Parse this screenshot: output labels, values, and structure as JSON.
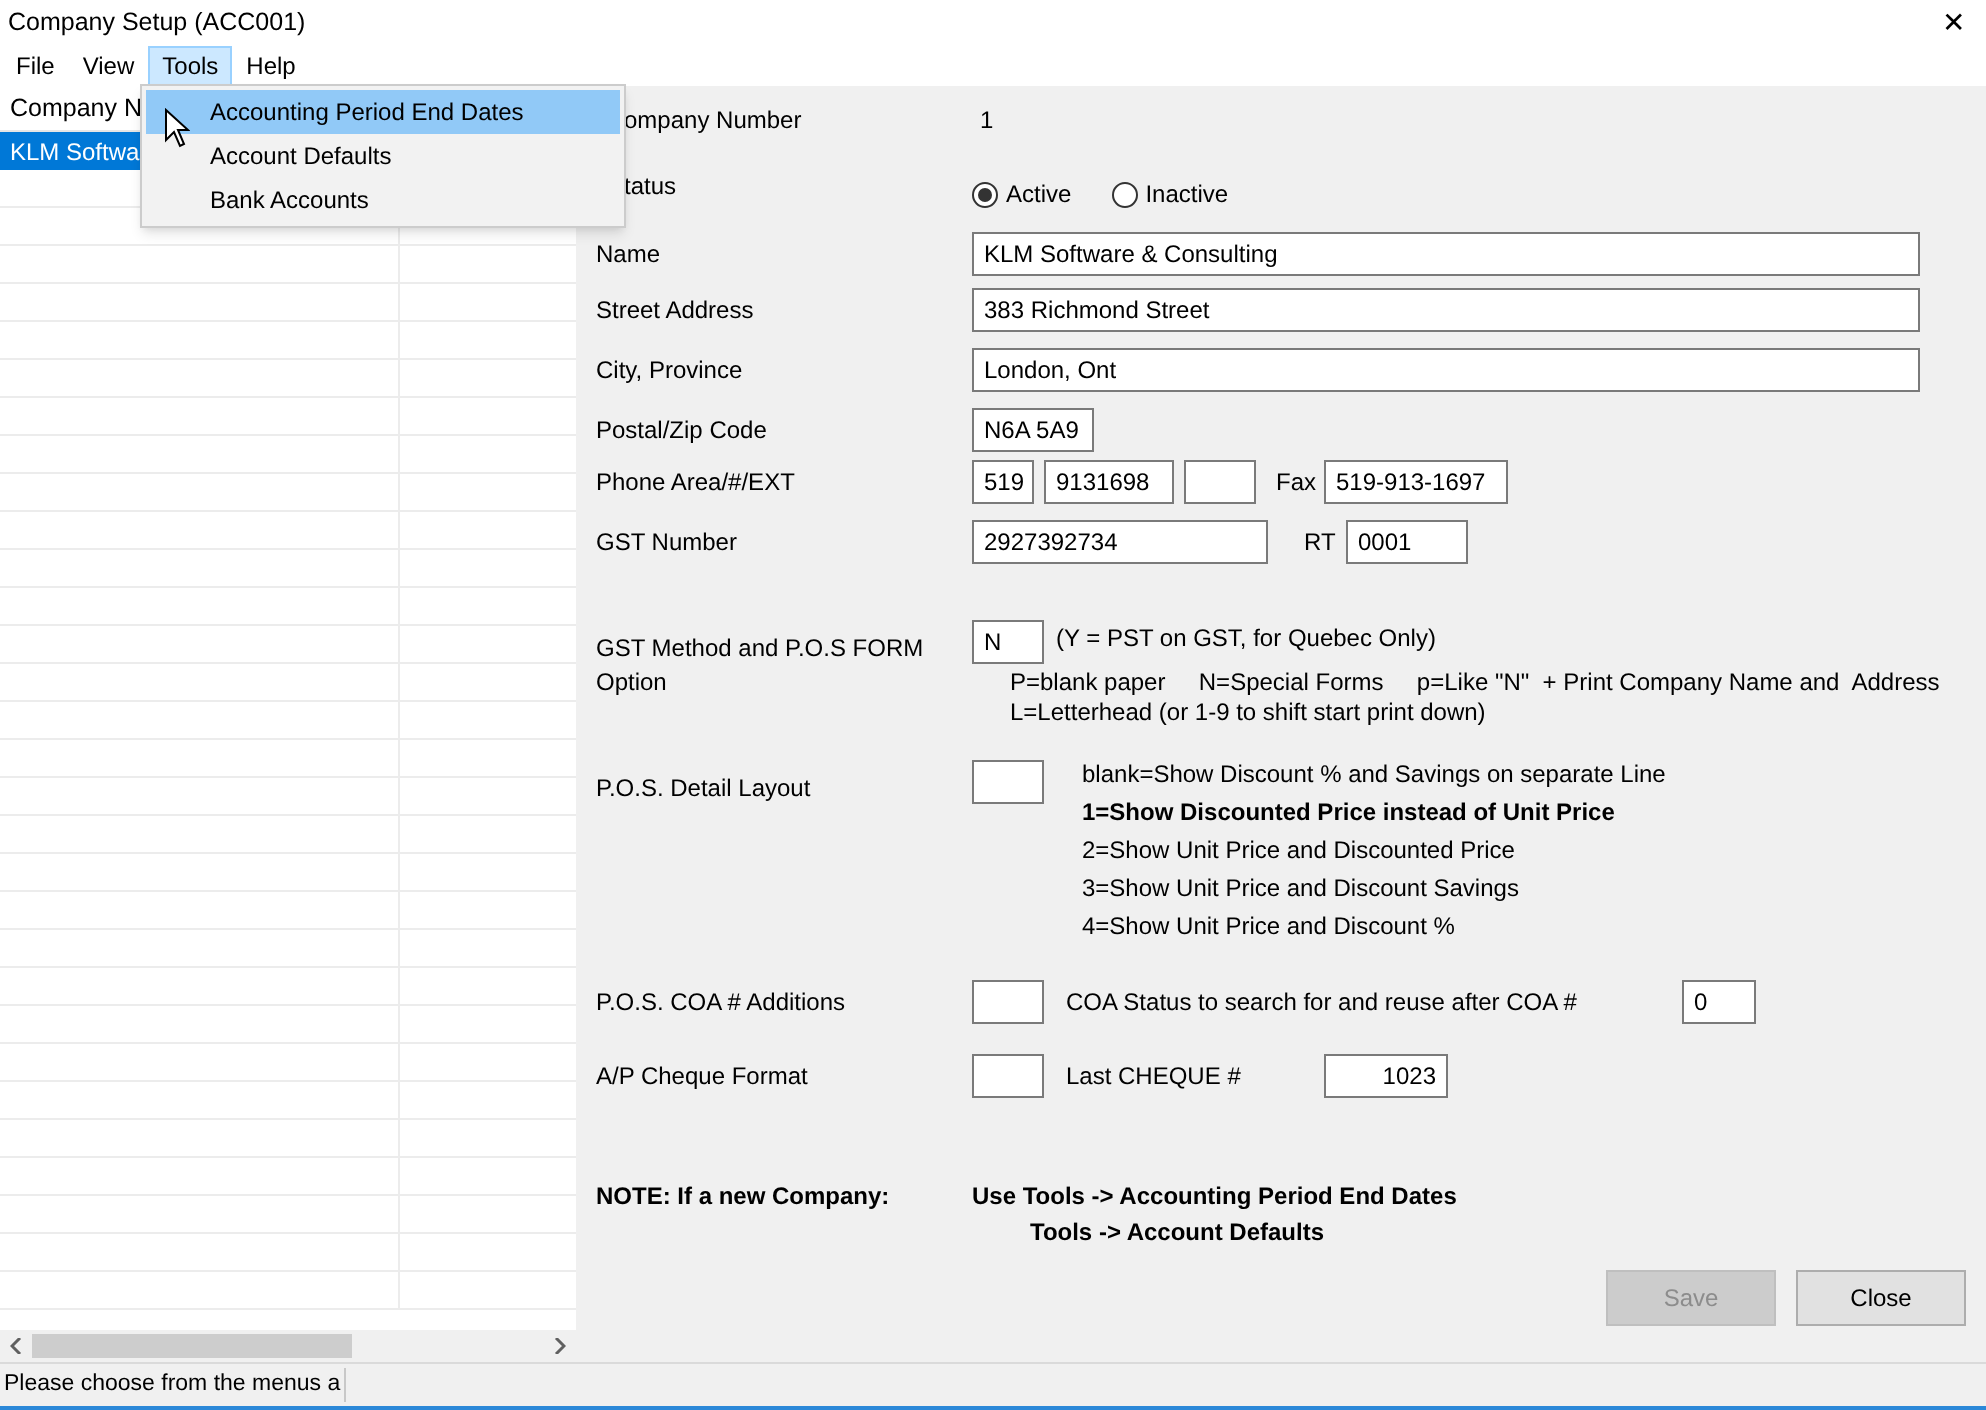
{
  "window": {
    "title": "Company Setup (ACC001)",
    "close": "✕"
  },
  "menu_bar": [
    {
      "label": "File",
      "selected": false
    },
    {
      "label": "View",
      "selected": false
    },
    {
      "label": "Tools",
      "selected": true
    },
    {
      "label": "Help",
      "selected": false
    }
  ],
  "menu": {
    "items": [
      {
        "label": "Accounting Period End Dates",
        "selected": true
      },
      {
        "label": "Account Defaults",
        "selected": false
      },
      {
        "label": "Bank Accounts",
        "selected": false
      }
    ]
  },
  "company_list": {
    "column": "Company N",
    "rows": [
      {
        "cell": "KLM Softwa",
        "selected": true
      }
    ]
  },
  "form": {
    "company_number": {
      "label": "ompany Number",
      "value": "1"
    },
    "status": {
      "label": "tatus",
      "options": [
        {
          "label": "Active",
          "selected": true
        },
        {
          "label": "Inactive",
          "selected": false
        }
      ]
    },
    "name": {
      "label": "Name",
      "value": "KLM Software & Consulting"
    },
    "street": {
      "label": "Street Address",
      "value": "383 Richmond Street"
    },
    "city": {
      "label": "City, Province",
      "value": "London, Ont"
    },
    "postal": {
      "label": "Postal/Zip Code",
      "value": "N6A 5A9"
    },
    "phone": {
      "label": "Phone Area/#/EXT",
      "area": "519",
      "number": "9131698",
      "fax_label": "Fax",
      "fax": "519-913-1697"
    },
    "gst": {
      "label": "GST Number",
      "value": "2927392734",
      "rt_label": "RT",
      "rt": "0001"
    },
    "gst_method": {
      "label": "GST Method and P.O.S FORM Option",
      "value": "N",
      "note": "(Y = PST on GST, for Quebec Only)",
      "help": [
        "P=blank paper     N=Special Forms     p=Like \"N\"  + Print Company Name and  Address",
        "L=Letterhead (or 1-9 to shift start print down)"
      ]
    },
    "pos_detail": {
      "label": "P.O.S. Detail Layout",
      "options": [
        {
          "text": "blank=Show Discount % and Savings on separate Line",
          "selected": false
        },
        {
          "text": "1=Show Discounted Price instead of Unit Price",
          "selected": true
        },
        {
          "text": "2=Show Unit Price and Discounted Price",
          "selected": false
        },
        {
          "text": "3=Show Unit Price and Discount Savings",
          "selected": false
        },
        {
          "text": "4=Show Unit Price and Discount %",
          "selected": false
        }
      ]
    },
    "coa": {
      "label": "P.O.S. COA # Additions",
      "status_label": "COA Status to search for and reuse after COA #",
      "status_value": "0"
    },
    "cheque": {
      "label": "A/P Cheque Format",
      "last_label": "Last CHEQUE #",
      "last_value": "1023"
    },
    "note": {
      "label": "NOTE:  If a new Company:",
      "lines": [
        "Use Tools -> Accounting Period End Dates",
        "Tools -> Account Defaults"
      ]
    }
  },
  "buttons": [
    {
      "label": "Save",
      "disabled": true
    },
    {
      "label": "Close",
      "disabled": false
    }
  ],
  "status_bar": {
    "text": "Please choose from the menus a"
  }
}
